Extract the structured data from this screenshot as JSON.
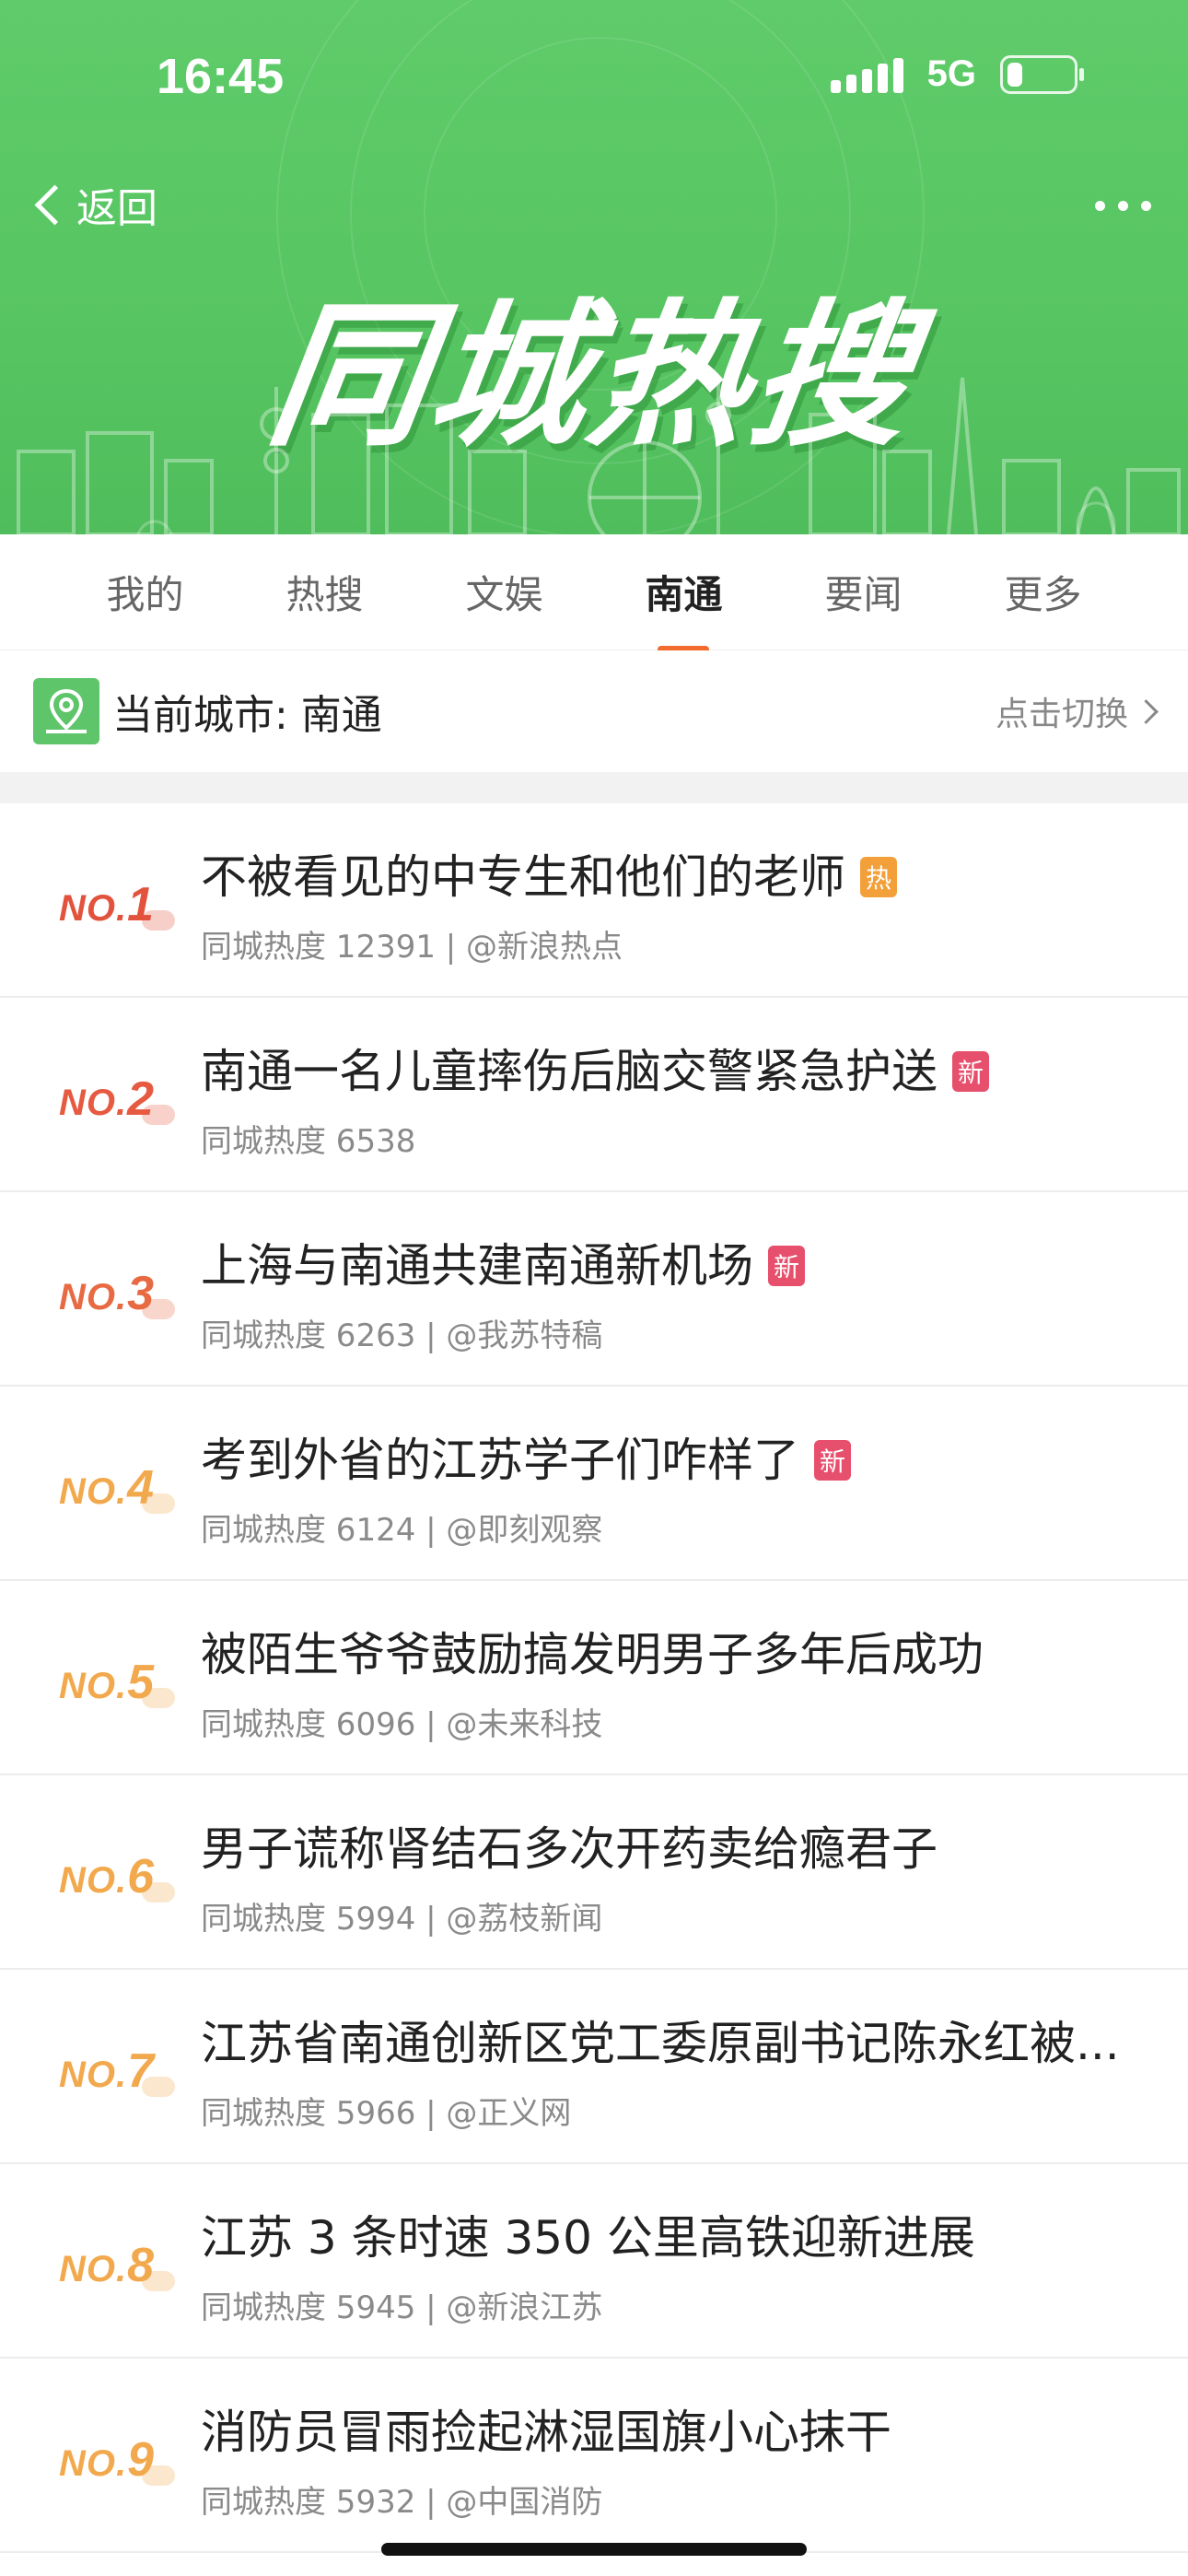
{
  "status_bar": {
    "time": "16:45",
    "network": "5G"
  },
  "header": {
    "back_label": "返回",
    "banner_title": "同城热搜"
  },
  "tabs": [
    {
      "label": "我的",
      "active": false
    },
    {
      "label": "热搜",
      "active": false
    },
    {
      "label": "文娱",
      "active": false
    },
    {
      "label": "南通",
      "active": true
    },
    {
      "label": "要闻",
      "active": false
    },
    {
      "label": "更多",
      "active": false
    }
  ],
  "city_bar": {
    "label": "当前城市: 南通",
    "switch_label": "点击切换"
  },
  "list": [
    {
      "rank_prefix": "NO.",
      "rank": "1",
      "title": "不被看见的中专生和他们的老师",
      "badge": "热",
      "meta": "同城热度 12391 | @新浪热点"
    },
    {
      "rank_prefix": "NO.",
      "rank": "2",
      "title": "南通一名儿童摔伤后脑交警紧急护送",
      "badge": "新",
      "meta": "同城热度 6538"
    },
    {
      "rank_prefix": "NO.",
      "rank": "3",
      "title": "上海与南通共建南通新机场",
      "badge": "新",
      "meta": "同城热度 6263 | @我苏特稿"
    },
    {
      "rank_prefix": "NO.",
      "rank": "4",
      "title": "考到外省的江苏学子们咋样了",
      "badge": "新",
      "meta": "同城热度 6124 | @即刻观察"
    },
    {
      "rank_prefix": "NO.",
      "rank": "5",
      "title": "被陌生爷爷鼓励搞发明男子多年后成功",
      "badge": "",
      "meta": "同城热度 6096 | @未来科技"
    },
    {
      "rank_prefix": "NO.",
      "rank": "6",
      "title": "男子谎称肾结石多次开药卖给瘾君子",
      "badge": "",
      "meta": "同城热度 5994 | @荔枝新闻"
    },
    {
      "rank_prefix": "NO.",
      "rank": "7",
      "title": "江苏省南通创新区党工委原副书记陈永红被...",
      "badge": "",
      "meta": "同城热度 5966 | @正义网"
    },
    {
      "rank_prefix": "NO.",
      "rank": "8",
      "title": "江苏 3 条时速 350 公里高铁迎新进展",
      "badge": "",
      "meta": "同城热度 5945 | @新浪江苏"
    },
    {
      "rank_prefix": "NO.",
      "rank": "9",
      "title": "消防员冒雨捡起淋湿国旗小心抹干",
      "badge": "",
      "meta": "同城热度 5932 | @中国消防"
    }
  ],
  "colors": {
    "banner_green": "#57c562",
    "accent_orange": "#f26a2e",
    "badge_hot": "#f3a03a",
    "badge_new": "#e7506d"
  }
}
